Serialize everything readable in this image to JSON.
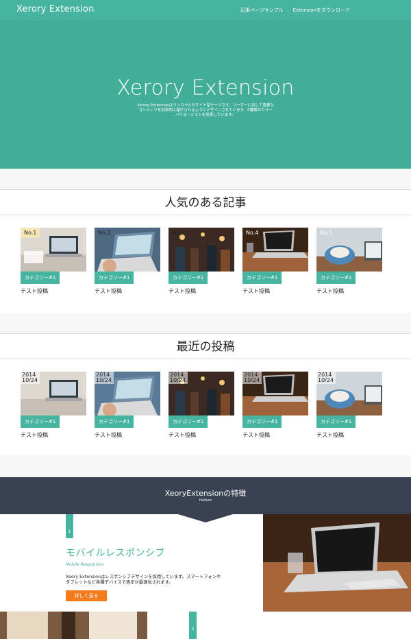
{
  "header": {
    "brand": "Xerory Extension",
    "nav": [
      "記事ページサンプル",
      "Extensionをダウンロード"
    ]
  },
  "hero": {
    "title": "Xerory Extension",
    "description": "Xerory Extensionはワンカラムのサイト型テーマです。ユーザーに対して重要なコンテンツを効率的に届けられるようにデザインされています。5種類のカラーバリエーションを用意しています。"
  },
  "popular": {
    "title": "人気のある記事",
    "items": [
      {
        "rank": "No.1",
        "category": "カテゴリー#1",
        "title": "テスト投稿"
      },
      {
        "rank": "No.2",
        "category": "カテゴリー#1",
        "title": "テスト投稿"
      },
      {
        "rank": "No.3",
        "category": "カテゴリー#1",
        "title": "テスト投稿"
      },
      {
        "rank": "No.4",
        "category": "カテゴリー#1",
        "title": "テスト投稿"
      },
      {
        "rank": "No.5",
        "category": "カテゴリー#1",
        "title": "テスト投稿"
      }
    ]
  },
  "recent": {
    "title": "最近の投稿",
    "items": [
      {
        "year": "2014",
        "md": "10/24",
        "category": "カテゴリー#1",
        "title": "テスト投稿"
      },
      {
        "year": "2014",
        "md": "10/24",
        "category": "カテゴリー#1",
        "title": "テスト投稿"
      },
      {
        "year": "2014",
        "md": "10/24",
        "category": "カテゴリー#1",
        "title": "テスト投稿"
      },
      {
        "year": "2014",
        "md": "10/24",
        "category": "カテゴリー#1",
        "title": "テスト投稿"
      },
      {
        "year": "2014",
        "md": "10/24",
        "category": "カテゴリー#1",
        "title": "テスト投稿"
      }
    ]
  },
  "feature": {
    "title": "XeoryExtensionの特徴",
    "subtitle": "feature",
    "item1": {
      "number": "1",
      "title": "モバイルレスポンシブ",
      "en": "Mobile Responsive",
      "description": "Xeory Extensionはレスポンシブデザインを採用しています。スマートフォンやタブレットなど各種デバイスで表示が最適化されます。",
      "button": "詳しく見る"
    },
    "item2": {
      "number": "2"
    }
  },
  "colors": {
    "accent": "#46b49e",
    "dark": "#3a4150",
    "button": "#f27a1a"
  },
  "icons": [
    "laptop-photo",
    "cafe-photo"
  ]
}
